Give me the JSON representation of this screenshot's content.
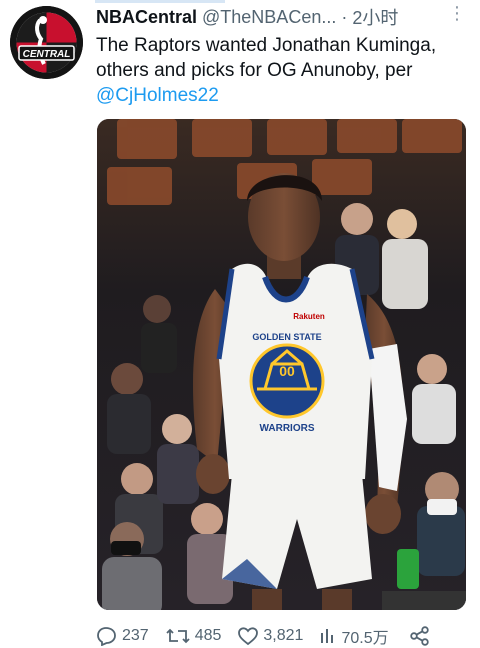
{
  "tweet": {
    "author_name": "NBACentral",
    "author_handle": "@TheNBACen...",
    "separator": "·",
    "time_ago": "2小时",
    "more_glyph": "⋮",
    "text_lines": [
      "The Raptors wanted Jonathan Kuminga,",
      "others and picks for OG Anunoby, per"
    ],
    "mention": "@CjHolmes22"
  },
  "avatar": {
    "logo_text": "CENTRAL"
  },
  "media": {
    "jersey_sponsor": "Rakuten",
    "jersey_top_text": "GOLDEN STATE",
    "jersey_bottom_text": "WARRIORS",
    "jersey_number": "00"
  },
  "actions": {
    "reply_count": "237",
    "retweet_count": "485",
    "like_count": "3,821",
    "views_count": "70.5万"
  },
  "colors": {
    "mention": "#1d9bf0",
    "secondary_text": "#536471",
    "warriors_blue": "#1d428a",
    "warriors_gold": "#ffc72c"
  }
}
